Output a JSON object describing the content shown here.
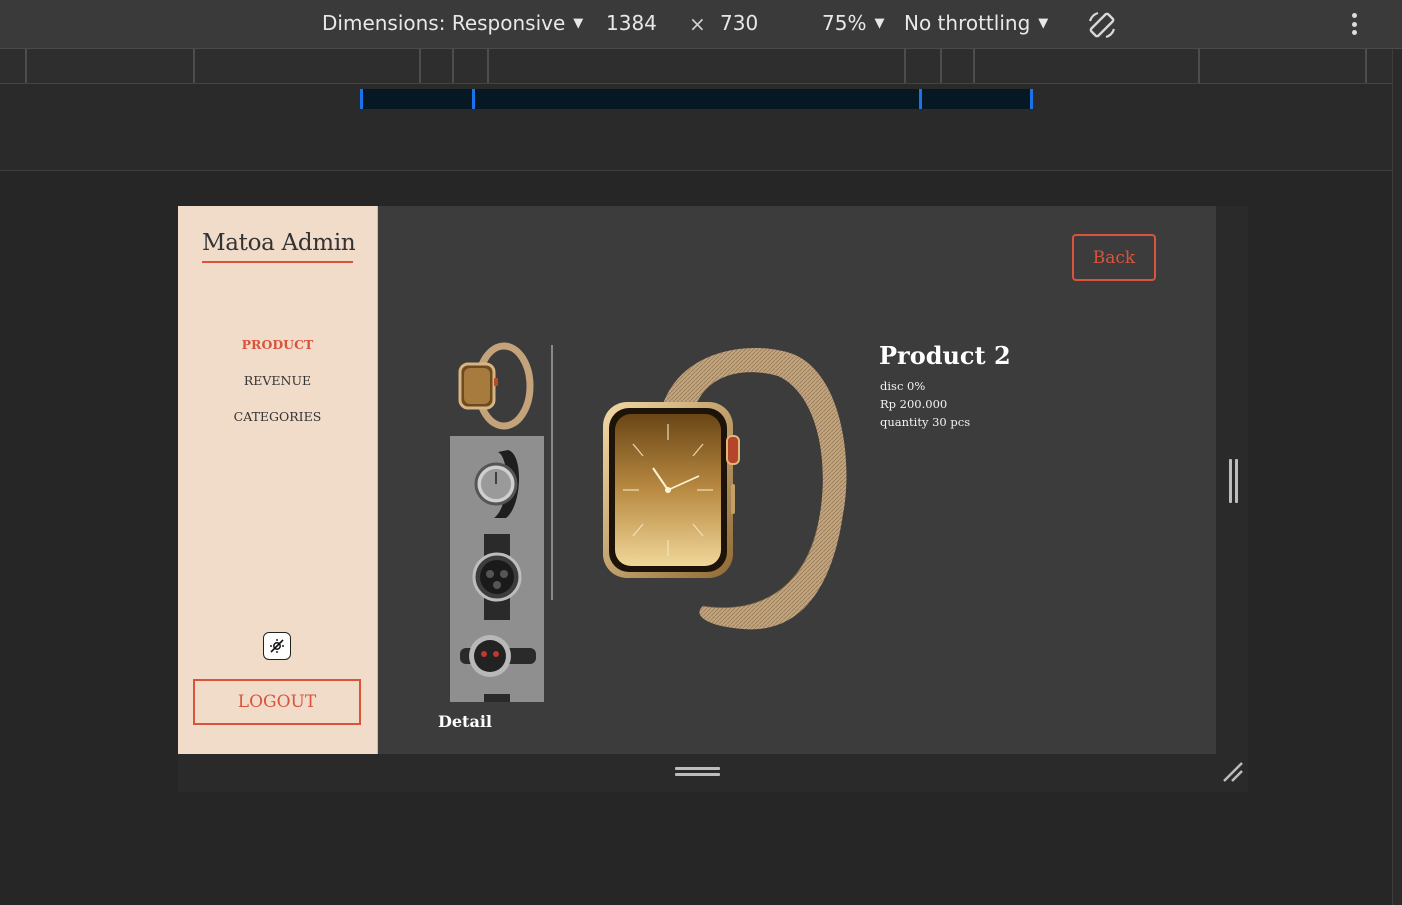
{
  "devtools": {
    "dimensions_label": "Dimensions: Responsive",
    "width": "1384",
    "times": "×",
    "height": "730",
    "zoom": "75%",
    "throttling": "No throttling",
    "rotate_icon": "rotate-icon",
    "more_icon": "more-vertical-icon"
  },
  "app": {
    "brand": "Matoa Admin",
    "nav": [
      {
        "label": "PRODUCT",
        "active": true
      },
      {
        "label": "REVENUE",
        "active": false
      },
      {
        "label": "CATEGORIES",
        "active": false
      }
    ],
    "logout_label": "LOGOUT",
    "theme_toggle_icon": "theme-toggle-icon",
    "accent": "#d9543c",
    "sidebar_bg": "#f1dcca",
    "content_bg": "#3c3c3c"
  },
  "product": {
    "back_label": "Back",
    "name": "Product 2",
    "disc": "disc 0%",
    "price": "Rp 200.000",
    "quantity": "quantity 30 pcs",
    "detail_heading": "Detail"
  }
}
